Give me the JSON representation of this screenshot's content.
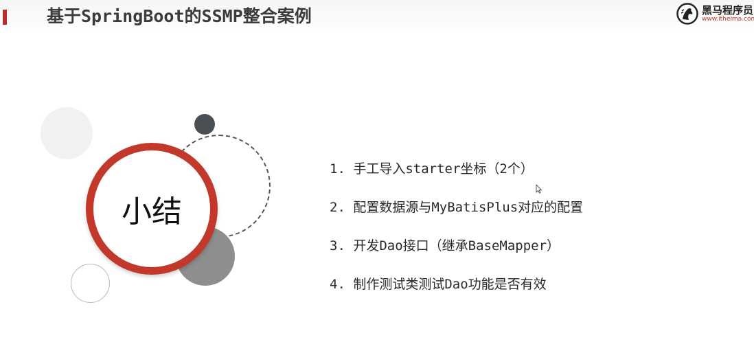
{
  "header": {
    "title": "基于SpringBoot的SSMP整合案例",
    "accent_color": "#b5302a"
  },
  "logo": {
    "icon": "horse-logo-icon",
    "name": "黑马程序员",
    "url": "www.itheima.com"
  },
  "badge": {
    "label": "小结",
    "ring_color": "#c2392b"
  },
  "summary": {
    "items": [
      "1. 手工导入starter坐标（2个）",
      "2. 配置数据源与MyBatisPlus对应的配置",
      "3. 开发Dao接口（继承BaseMapper）",
      "4. 制作测试类测试Dao功能是否有效"
    ]
  }
}
